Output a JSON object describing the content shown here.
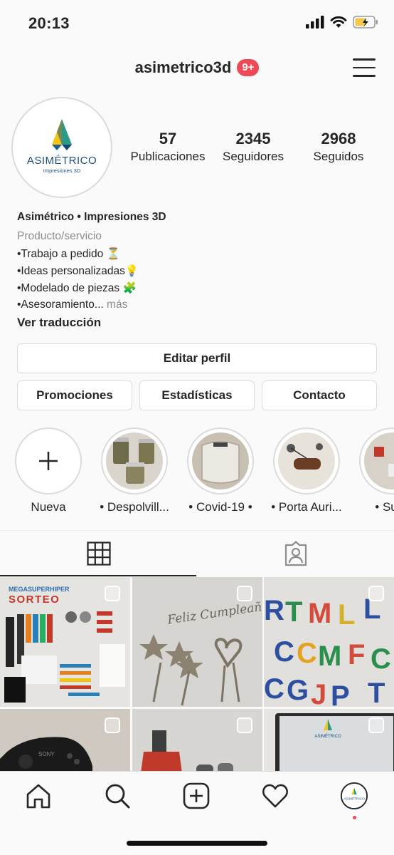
{
  "status": {
    "time": "20:13"
  },
  "header": {
    "username": "asimetrico3d",
    "notifications": "9+"
  },
  "profile": {
    "logo_text": "ASIMÉTRICO",
    "logo_subtext": "Impresiones 3D",
    "stats": [
      {
        "number": "57",
        "label": "Publicaciones"
      },
      {
        "number": "2345",
        "label": "Seguidores"
      },
      {
        "number": "2968",
        "label": "Seguidos"
      }
    ]
  },
  "bio": {
    "name": "Asimétrico • Impresiones 3D",
    "category": "Producto/servicio",
    "lines": [
      "•Trabajo a pedido ⏳",
      "•Ideas personalizadas💡",
      "•Modelado de piezas 🧩",
      "•Asesoramiento..."
    ],
    "more": "más",
    "translate": "Ver traducción"
  },
  "buttons": {
    "edit": "Editar perfil",
    "promotions": "Promociones",
    "stats": "Estadísticas",
    "contact": "Contacto"
  },
  "highlights": [
    {
      "label": "Nueva"
    },
    {
      "label": "• Despolvill..."
    },
    {
      "label": "• Covid-19 •"
    },
    {
      "label": "• Porta Auri..."
    },
    {
      "label": "• Sujet"
    }
  ],
  "grid": {
    "post1": {
      "line1": "MEGASUPERHIPER",
      "line2": "SORTEO"
    },
    "post2": {
      "text": "Feliz Cumpleaños"
    },
    "post3": {
      "letters": "RTMLCMFGJPT"
    },
    "post4": {
      "brand": "SONY"
    },
    "post6": {
      "logo": "ASIMÉTRICO"
    }
  },
  "bottom_nav": {
    "avatar_logo": "ASIMÉTRICO"
  }
}
